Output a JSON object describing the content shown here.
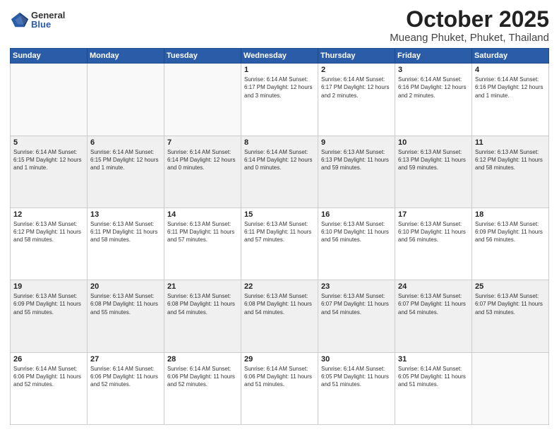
{
  "header": {
    "logo_general": "General",
    "logo_blue": "Blue",
    "month": "October 2025",
    "location": "Mueang Phuket, Phuket, Thailand"
  },
  "weekdays": [
    "Sunday",
    "Monday",
    "Tuesday",
    "Wednesday",
    "Thursday",
    "Friday",
    "Saturday"
  ],
  "weeks": [
    [
      {
        "day": "",
        "info": ""
      },
      {
        "day": "",
        "info": ""
      },
      {
        "day": "",
        "info": ""
      },
      {
        "day": "1",
        "info": "Sunrise: 6:14 AM\nSunset: 6:17 PM\nDaylight: 12 hours\nand 3 minutes."
      },
      {
        "day": "2",
        "info": "Sunrise: 6:14 AM\nSunset: 6:17 PM\nDaylight: 12 hours\nand 2 minutes."
      },
      {
        "day": "3",
        "info": "Sunrise: 6:14 AM\nSunset: 6:16 PM\nDaylight: 12 hours\nand 2 minutes."
      },
      {
        "day": "4",
        "info": "Sunrise: 6:14 AM\nSunset: 6:16 PM\nDaylight: 12 hours\nand 1 minute."
      }
    ],
    [
      {
        "day": "5",
        "info": "Sunrise: 6:14 AM\nSunset: 6:15 PM\nDaylight: 12 hours\nand 1 minute."
      },
      {
        "day": "6",
        "info": "Sunrise: 6:14 AM\nSunset: 6:15 PM\nDaylight: 12 hours\nand 1 minute."
      },
      {
        "day": "7",
        "info": "Sunrise: 6:14 AM\nSunset: 6:14 PM\nDaylight: 12 hours\nand 0 minutes."
      },
      {
        "day": "8",
        "info": "Sunrise: 6:14 AM\nSunset: 6:14 PM\nDaylight: 12 hours\nand 0 minutes."
      },
      {
        "day": "9",
        "info": "Sunrise: 6:13 AM\nSunset: 6:13 PM\nDaylight: 11 hours\nand 59 minutes."
      },
      {
        "day": "10",
        "info": "Sunrise: 6:13 AM\nSunset: 6:13 PM\nDaylight: 11 hours\nand 59 minutes."
      },
      {
        "day": "11",
        "info": "Sunrise: 6:13 AM\nSunset: 6:12 PM\nDaylight: 11 hours\nand 58 minutes."
      }
    ],
    [
      {
        "day": "12",
        "info": "Sunrise: 6:13 AM\nSunset: 6:12 PM\nDaylight: 11 hours\nand 58 minutes."
      },
      {
        "day": "13",
        "info": "Sunrise: 6:13 AM\nSunset: 6:11 PM\nDaylight: 11 hours\nand 58 minutes."
      },
      {
        "day": "14",
        "info": "Sunrise: 6:13 AM\nSunset: 6:11 PM\nDaylight: 11 hours\nand 57 minutes."
      },
      {
        "day": "15",
        "info": "Sunrise: 6:13 AM\nSunset: 6:11 PM\nDaylight: 11 hours\nand 57 minutes."
      },
      {
        "day": "16",
        "info": "Sunrise: 6:13 AM\nSunset: 6:10 PM\nDaylight: 11 hours\nand 56 minutes."
      },
      {
        "day": "17",
        "info": "Sunrise: 6:13 AM\nSunset: 6:10 PM\nDaylight: 11 hours\nand 56 minutes."
      },
      {
        "day": "18",
        "info": "Sunrise: 6:13 AM\nSunset: 6:09 PM\nDaylight: 11 hours\nand 56 minutes."
      }
    ],
    [
      {
        "day": "19",
        "info": "Sunrise: 6:13 AM\nSunset: 6:09 PM\nDaylight: 11 hours\nand 55 minutes."
      },
      {
        "day": "20",
        "info": "Sunrise: 6:13 AM\nSunset: 6:08 PM\nDaylight: 11 hours\nand 55 minutes."
      },
      {
        "day": "21",
        "info": "Sunrise: 6:13 AM\nSunset: 6:08 PM\nDaylight: 11 hours\nand 54 minutes."
      },
      {
        "day": "22",
        "info": "Sunrise: 6:13 AM\nSunset: 6:08 PM\nDaylight: 11 hours\nand 54 minutes."
      },
      {
        "day": "23",
        "info": "Sunrise: 6:13 AM\nSunset: 6:07 PM\nDaylight: 11 hours\nand 54 minutes."
      },
      {
        "day": "24",
        "info": "Sunrise: 6:13 AM\nSunset: 6:07 PM\nDaylight: 11 hours\nand 54 minutes."
      },
      {
        "day": "25",
        "info": "Sunrise: 6:13 AM\nSunset: 6:07 PM\nDaylight: 11 hours\nand 53 minutes."
      }
    ],
    [
      {
        "day": "26",
        "info": "Sunrise: 6:14 AM\nSunset: 6:06 PM\nDaylight: 11 hours\nand 52 minutes."
      },
      {
        "day": "27",
        "info": "Sunrise: 6:14 AM\nSunset: 6:06 PM\nDaylight: 11 hours\nand 52 minutes."
      },
      {
        "day": "28",
        "info": "Sunrise: 6:14 AM\nSunset: 6:06 PM\nDaylight: 11 hours\nand 52 minutes."
      },
      {
        "day": "29",
        "info": "Sunrise: 6:14 AM\nSunset: 6:06 PM\nDaylight: 11 hours\nand 51 minutes."
      },
      {
        "day": "30",
        "info": "Sunrise: 6:14 AM\nSunset: 6:05 PM\nDaylight: 11 hours\nand 51 minutes."
      },
      {
        "day": "31",
        "info": "Sunrise: 6:14 AM\nSunset: 6:05 PM\nDaylight: 11 hours\nand 51 minutes."
      },
      {
        "day": "",
        "info": ""
      }
    ]
  ]
}
